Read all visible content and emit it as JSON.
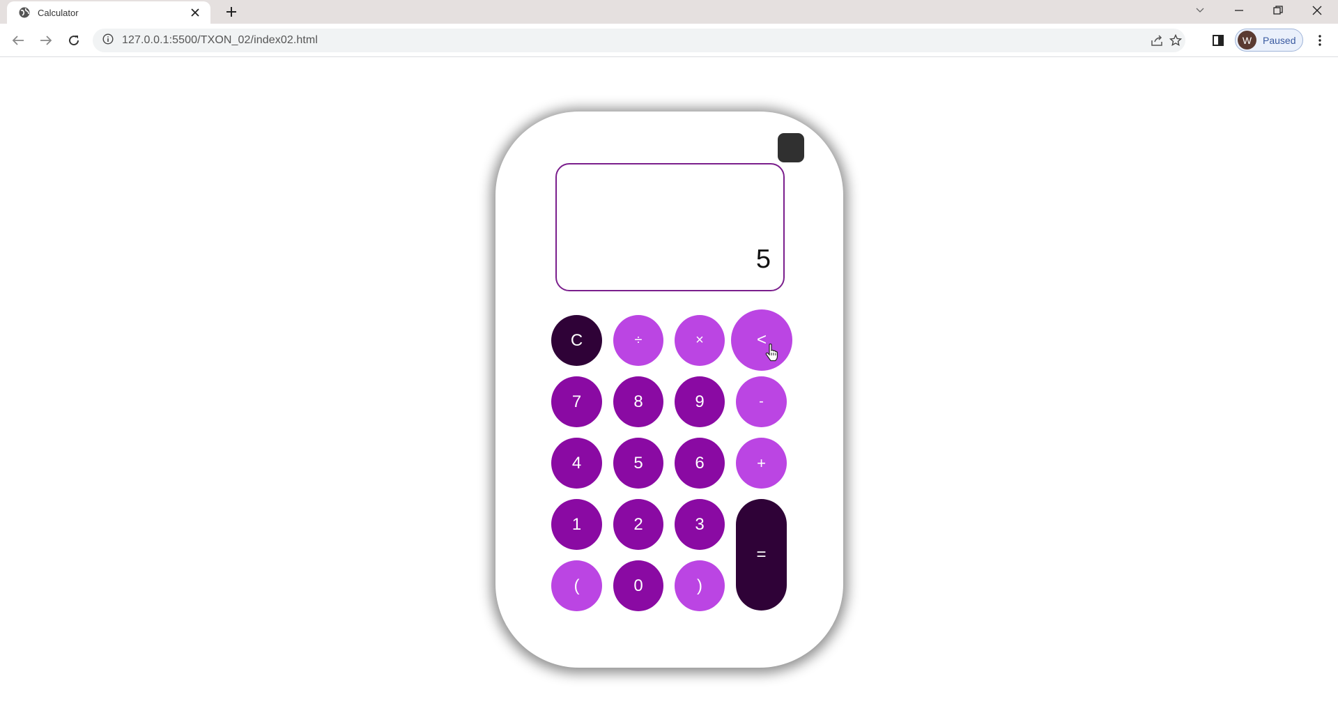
{
  "browser": {
    "tab_title": "Calculator",
    "url": "127.0.0.1:5500/TXON_02/index02.html",
    "profile_initial": "W",
    "profile_status": "Paused"
  },
  "calculator": {
    "display_value": "5",
    "keys": {
      "clear": "C",
      "divide": "÷",
      "multiply": "×",
      "backspace": "<",
      "seven": "7",
      "eight": "8",
      "nine": "9",
      "minus": "-",
      "four": "4",
      "five": "5",
      "six": "6",
      "plus": "+",
      "one": "1",
      "two": "2",
      "three": "3",
      "equals": "=",
      "open_paren": "(",
      "zero": "0",
      "close_paren": ")"
    },
    "colors": {
      "dark": "#2f0237",
      "number": "#8a0aa3",
      "operator": "#bb45e3",
      "display_border": "#7a1e8c"
    }
  }
}
